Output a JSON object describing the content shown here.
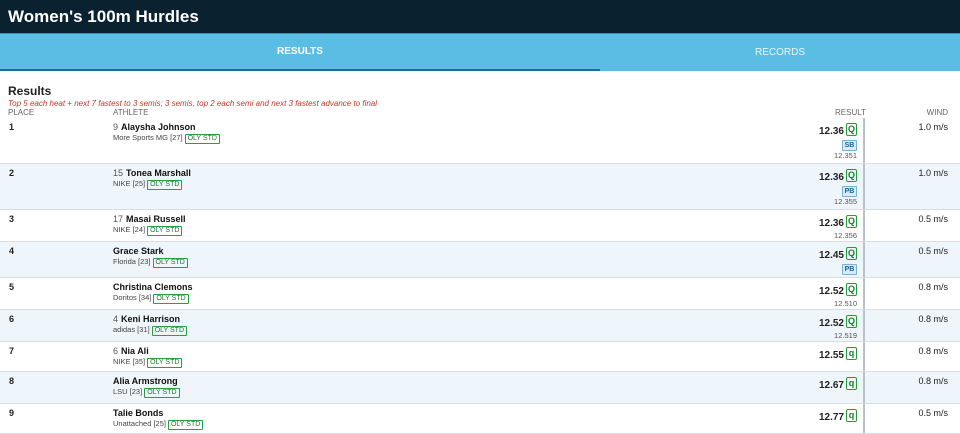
{
  "header": {
    "title": "Women's 100m Hurdles"
  },
  "tabs": [
    {
      "label": "RESULTS"
    },
    {
      "label": "RECORDS"
    }
  ],
  "section": {
    "title": "Results",
    "note": "Top 5 each heat + next 7 fastest to 3 semis; 3 semis, top 2 each semi and next 3 fastest advance to final"
  },
  "columns": {
    "place": "PLACE",
    "athlete": "ATHLETE",
    "result": "RESULT",
    "wind": "WIND"
  },
  "rows": [
    {
      "place": "1",
      "bib": "9",
      "name": "Alaysha Johnson",
      "affiliation": "More Sports MG [27]",
      "std": "OLY STD",
      "time": "12.36",
      "q": "Q",
      "badge": "SB",
      "precise": "12.351",
      "wind": "1.0 m/s"
    },
    {
      "place": "2",
      "bib": "15",
      "name": "Tonea Marshall",
      "affiliation": "NIKE [25]",
      "std": "OLY STD",
      "time": "12.36",
      "q": "Q",
      "badge": "PB",
      "precise": "12.355",
      "wind": "1.0 m/s"
    },
    {
      "place": "3",
      "bib": "17",
      "name": "Masai Russell",
      "affiliation": "NIKE [24]",
      "std": "OLY STD",
      "time": "12.36",
      "q": "Q",
      "badge": "",
      "precise": "12.356",
      "wind": "0.5 m/s"
    },
    {
      "place": "4",
      "bib": "",
      "name": "Grace Stark",
      "affiliation": "Florida [23]",
      "std": "OLY STD",
      "time": "12.45",
      "q": "Q",
      "badge": "PB",
      "precise": "",
      "wind": "0.5 m/s"
    },
    {
      "place": "5",
      "bib": "",
      "name": "Christina Clemons",
      "affiliation": "Doritos [34]",
      "std": "OLY STD",
      "time": "12.52",
      "q": "Q",
      "badge": "",
      "precise": "12.510",
      "wind": "0.8 m/s"
    },
    {
      "place": "6",
      "bib": "4",
      "name": "Keni Harrison",
      "affiliation": "adidas [31]",
      "std": "OLY STD",
      "time": "12.52",
      "q": "Q",
      "badge": "",
      "precise": "12.519",
      "wind": "0.8 m/s"
    },
    {
      "place": "7",
      "bib": "6",
      "name": "Nia Ali",
      "affiliation": "NIKE [35]",
      "std": "OLY STD",
      "time": "12.55",
      "q": "q",
      "badge": "",
      "precise": "",
      "wind": "0.8 m/s"
    },
    {
      "place": "8",
      "bib": "",
      "name": "Alia Armstrong",
      "affiliation": "LSU [23]",
      "std": "OLY STD",
      "time": "12.67",
      "q": "q",
      "badge": "",
      "precise": "",
      "wind": "0.8 m/s"
    },
    {
      "place": "9",
      "bib": "",
      "name": "Talie Bonds",
      "affiliation": "Unattached [25]",
      "std": "OLY STD",
      "time": "12.77",
      "q": "q",
      "badge": "",
      "precise": "",
      "wind": "0.5 m/s"
    }
  ]
}
